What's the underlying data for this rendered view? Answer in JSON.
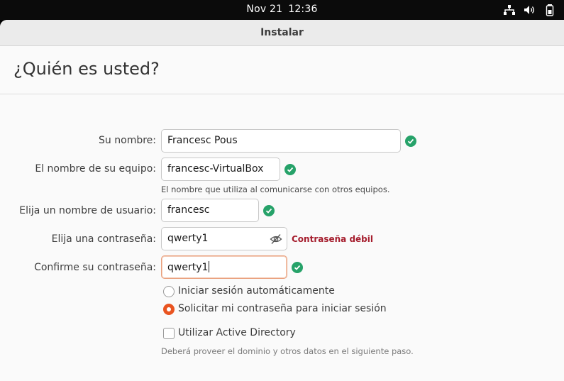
{
  "topbar": {
    "date": "Nov 21",
    "time": "12:36",
    "tray_icons": [
      "network-icon",
      "volume-icon",
      "battery-icon"
    ]
  },
  "window": {
    "title": "Instalar"
  },
  "page": {
    "heading": "¿Quién es usted?"
  },
  "form": {
    "name": {
      "label": "Su nombre:",
      "value": "Francesc Pous",
      "valid": true
    },
    "computer_name": {
      "label": "El nombre de su equipo:",
      "value": "francesc-VirtualBox",
      "hint": "El nombre que utiliza al comunicarse con otros equipos.",
      "valid": true
    },
    "username": {
      "label": "Elija un nombre de usuario:",
      "value": "francesc",
      "valid": true
    },
    "password": {
      "label": "Elija una contraseña:",
      "value": "qwerty1",
      "strength": "Contraseña débil",
      "strength_color": "#a51d2d"
    },
    "confirm_password": {
      "label": "Confirme su contraseña:",
      "value": "qwerty1",
      "valid": true
    },
    "login_options": [
      {
        "label": "Iniciar sesión automáticamente",
        "selected": false
      },
      {
        "label": "Solicitar mi contraseña para iniciar sesión",
        "selected": true
      }
    ],
    "active_directory": {
      "label": "Utilizar Active Directory",
      "checked": false,
      "hint": "Deberá proveer el dominio y otros datos en el siguiente paso."
    }
  },
  "colors": {
    "accent": "#e95420",
    "valid": "#26a269"
  }
}
